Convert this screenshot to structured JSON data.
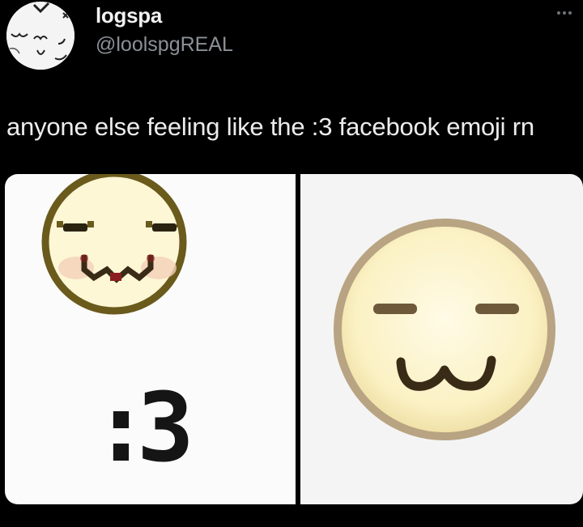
{
  "author": {
    "display_name": "logspa",
    "handle": "@loolspgREAL",
    "avatar_icon": "cat-face-doodle-icon"
  },
  "more_icon": "more-options-icon",
  "tweet": {
    "text": "anyone else feeling like the :3 facebook emoji rn"
  },
  "media": {
    "left": {
      "icon": "pixel-colon-three-emoji-icon",
      "caption": ":3"
    },
    "right": {
      "icon": "smooth-colon-three-emoji-icon"
    }
  },
  "colors": {
    "background": "#000000",
    "text": "#e7e9ea",
    "handle": "#8b9096",
    "emoji_face": "#fdf6d0",
    "emoji_outline_right": "#b8a482",
    "emoji_outline_left": "#6a5a1c",
    "emoji_mouth": "#3a2b16"
  }
}
